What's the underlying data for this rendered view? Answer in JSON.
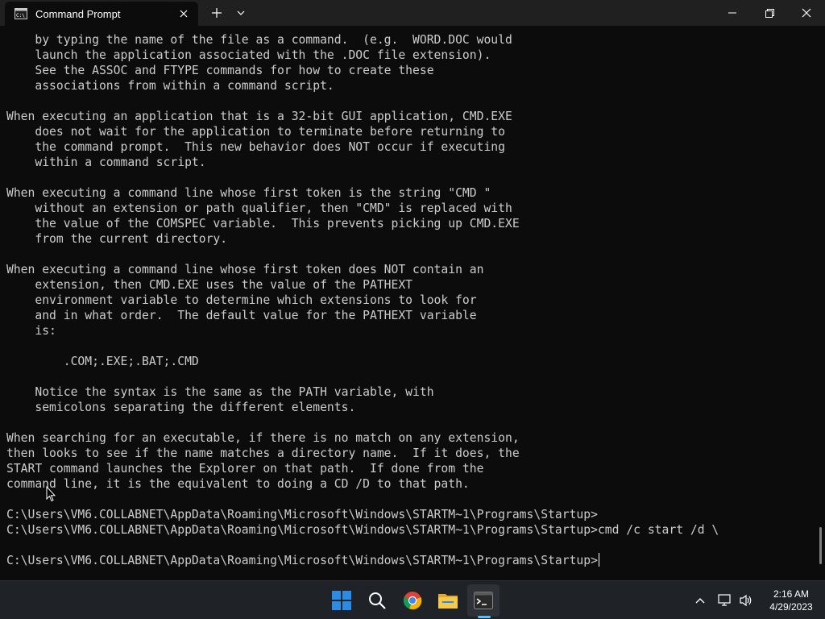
{
  "window": {
    "tab_title": "Command Prompt",
    "icons": {
      "tab": "cmd-icon",
      "tab_close": "close-icon",
      "new_tab": "plus-icon",
      "dropdown": "chevron-down-icon",
      "minimize": "minimize-icon",
      "maximize": "maximize-icon",
      "close": "close-icon"
    }
  },
  "terminal": {
    "colors": {
      "background": "#0c0c0c",
      "text": "#cccccc"
    },
    "lines": [
      "    by typing the name of the file as a command.  (e.g.  WORD.DOC would",
      "    launch the application associated with the .DOC file extension).",
      "    See the ASSOC and FTYPE commands for how to create these",
      "    associations from within a command script.",
      "",
      "When executing an application that is a 32-bit GUI application, CMD.EXE",
      "    does not wait for the application to terminate before returning to",
      "    the command prompt.  This new behavior does NOT occur if executing",
      "    within a command script.",
      "",
      "When executing a command line whose first token is the string \"CMD \"",
      "    without an extension or path qualifier, then \"CMD\" is replaced with",
      "    the value of the COMSPEC variable.  This prevents picking up CMD.EXE",
      "    from the current directory.",
      "",
      "When executing a command line whose first token does NOT contain an",
      "    extension, then CMD.EXE uses the value of the PATHEXT",
      "    environment variable to determine which extensions to look for",
      "    and in what order.  The default value for the PATHEXT variable",
      "    is:",
      "",
      "        .COM;.EXE;.BAT;.CMD",
      "",
      "    Notice the syntax is the same as the PATH variable, with",
      "    semicolons separating the different elements.",
      "",
      "When searching for an executable, if there is no match on any extension,",
      "then looks to see if the name matches a directory name.  If it does, the",
      "START command launches the Explorer on that path.  If done from the",
      "command line, it is the equivalent to doing a CD /D to that path.",
      "",
      "C:\\Users\\VM6.COLLABNET\\AppData\\Roaming\\Microsoft\\Windows\\STARTM~1\\Programs\\Startup>",
      "C:\\Users\\VM6.COLLABNET\\AppData\\Roaming\\Microsoft\\Windows\\STARTM~1\\Programs\\Startup>cmd /c start /d \\",
      ""
    ],
    "prompt": "C:\\Users\\VM6.COLLABNET\\AppData\\Roaming\\Microsoft\\Windows\\STARTM~1\\Programs\\Startup>"
  },
  "taskbar": {
    "apps": [
      {
        "name": "windows-start-icon"
      },
      {
        "name": "search-icon"
      },
      {
        "name": "chrome-icon"
      },
      {
        "name": "file-explorer-icon"
      },
      {
        "name": "terminal-icon",
        "active": true
      }
    ],
    "tray": {
      "icons": [
        "chevron-up-icon",
        "network-icon",
        "volume-icon"
      ],
      "time": "2:16 AM",
      "date": "4/29/2023"
    },
    "colors": {
      "active_indicator": "#4cc2ff"
    }
  }
}
